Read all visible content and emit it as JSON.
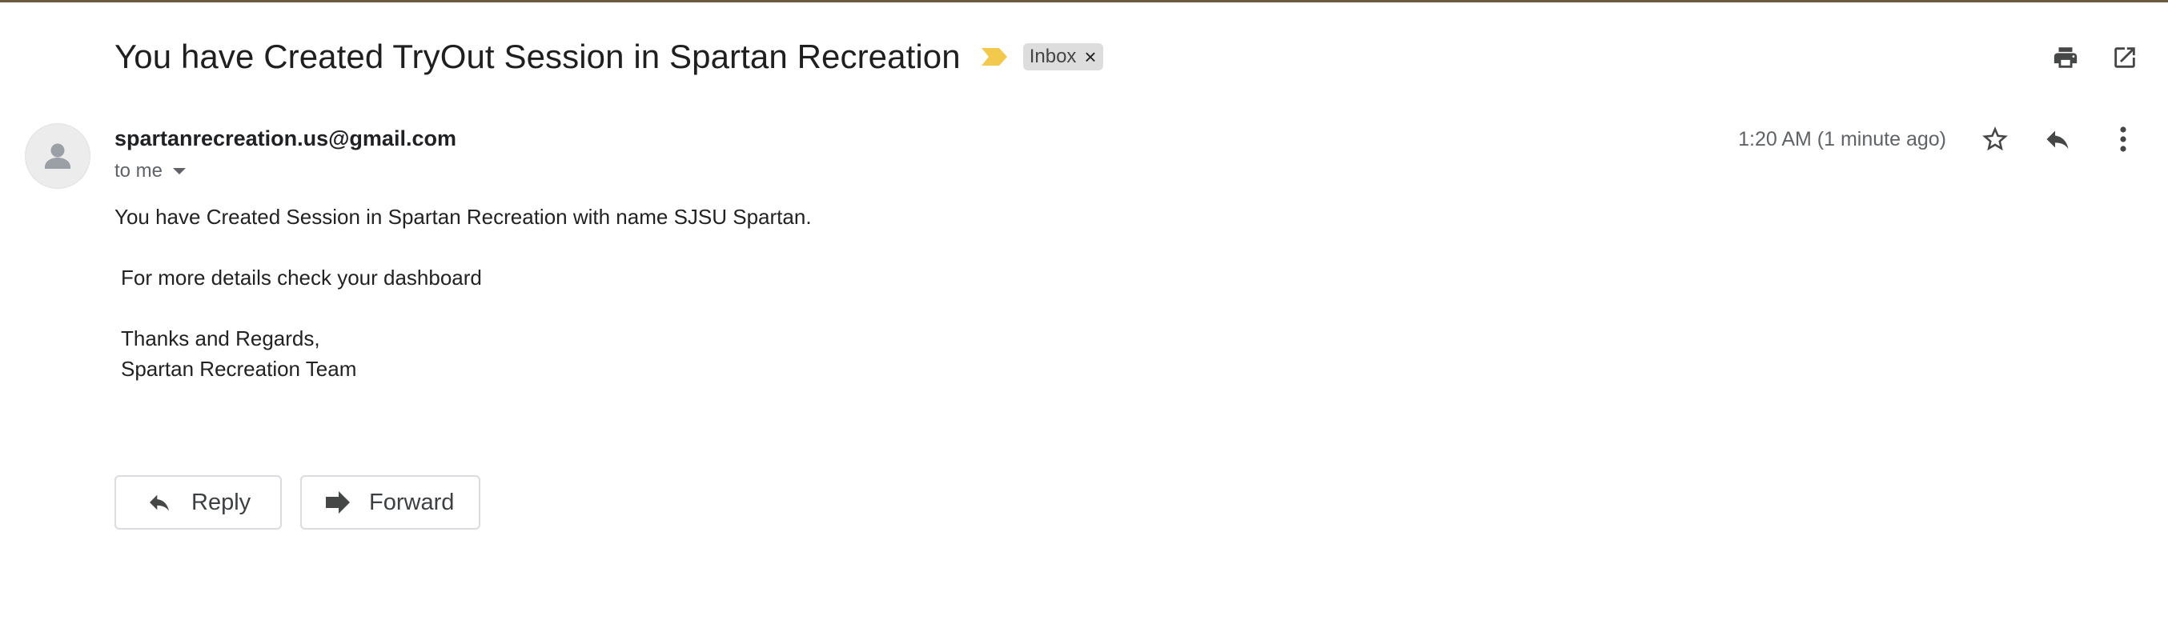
{
  "email": {
    "subject": "You have Created TryOut Session in Spartan Recreation",
    "label": "Inbox",
    "label_remove": "×",
    "sender": "spartanrecreation.us@gmail.com",
    "recipient_text": "to me",
    "time": "1:20 AM (1 minute ago)",
    "body": {
      "line1": "You have Created Session in Spartan Recreation with name SJSU Spartan.",
      "line2": "For more details check your dashboard",
      "line3": "Thanks and Regards,",
      "line4": "Spartan Recreation Team"
    }
  },
  "actions": {
    "reply_label": "Reply",
    "forward_label": "Forward"
  },
  "icons": {
    "importance": "importance-marker-icon",
    "print": "print-icon",
    "open_new": "open-in-new-window-icon",
    "star": "star-icon",
    "reply": "reply-icon",
    "more": "more-vert-icon",
    "dropdown": "chevron-down-icon",
    "avatar": "person-icon",
    "forward": "forward-icon"
  },
  "colors": {
    "importance": "#f2c94c",
    "label_bg": "#dddddd",
    "icon": "#444746"
  }
}
